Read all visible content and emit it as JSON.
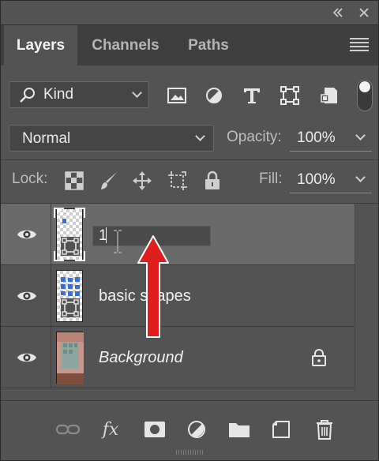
{
  "panel": {
    "tabs": [
      {
        "label": "Layers",
        "active": true
      },
      {
        "label": "Channels",
        "active": false
      },
      {
        "label": "Paths",
        "active": false
      }
    ]
  },
  "filter": {
    "kind_label": "Kind",
    "icons": [
      "image-filter-icon",
      "adjustment-filter-icon",
      "type-filter-icon",
      "shape-filter-icon",
      "smart-object-filter-icon"
    ]
  },
  "blend": {
    "mode": "Normal",
    "opacity_label": "Opacity:",
    "opacity_value": "100%"
  },
  "lock": {
    "label": "Lock:",
    "fill_label": "Fill:",
    "fill_value": "100%"
  },
  "layers": [
    {
      "name": "1",
      "editing": true,
      "selected": true
    },
    {
      "name": "basic shapes",
      "editing": false,
      "selected": false
    },
    {
      "name": "Background",
      "editing": false,
      "selected": false,
      "italic": true,
      "locked": true
    }
  ],
  "colors": {
    "panel_bg": "#535353",
    "selected_row": "#6a6a6a",
    "annotation_arrow": "#e01e1e"
  }
}
